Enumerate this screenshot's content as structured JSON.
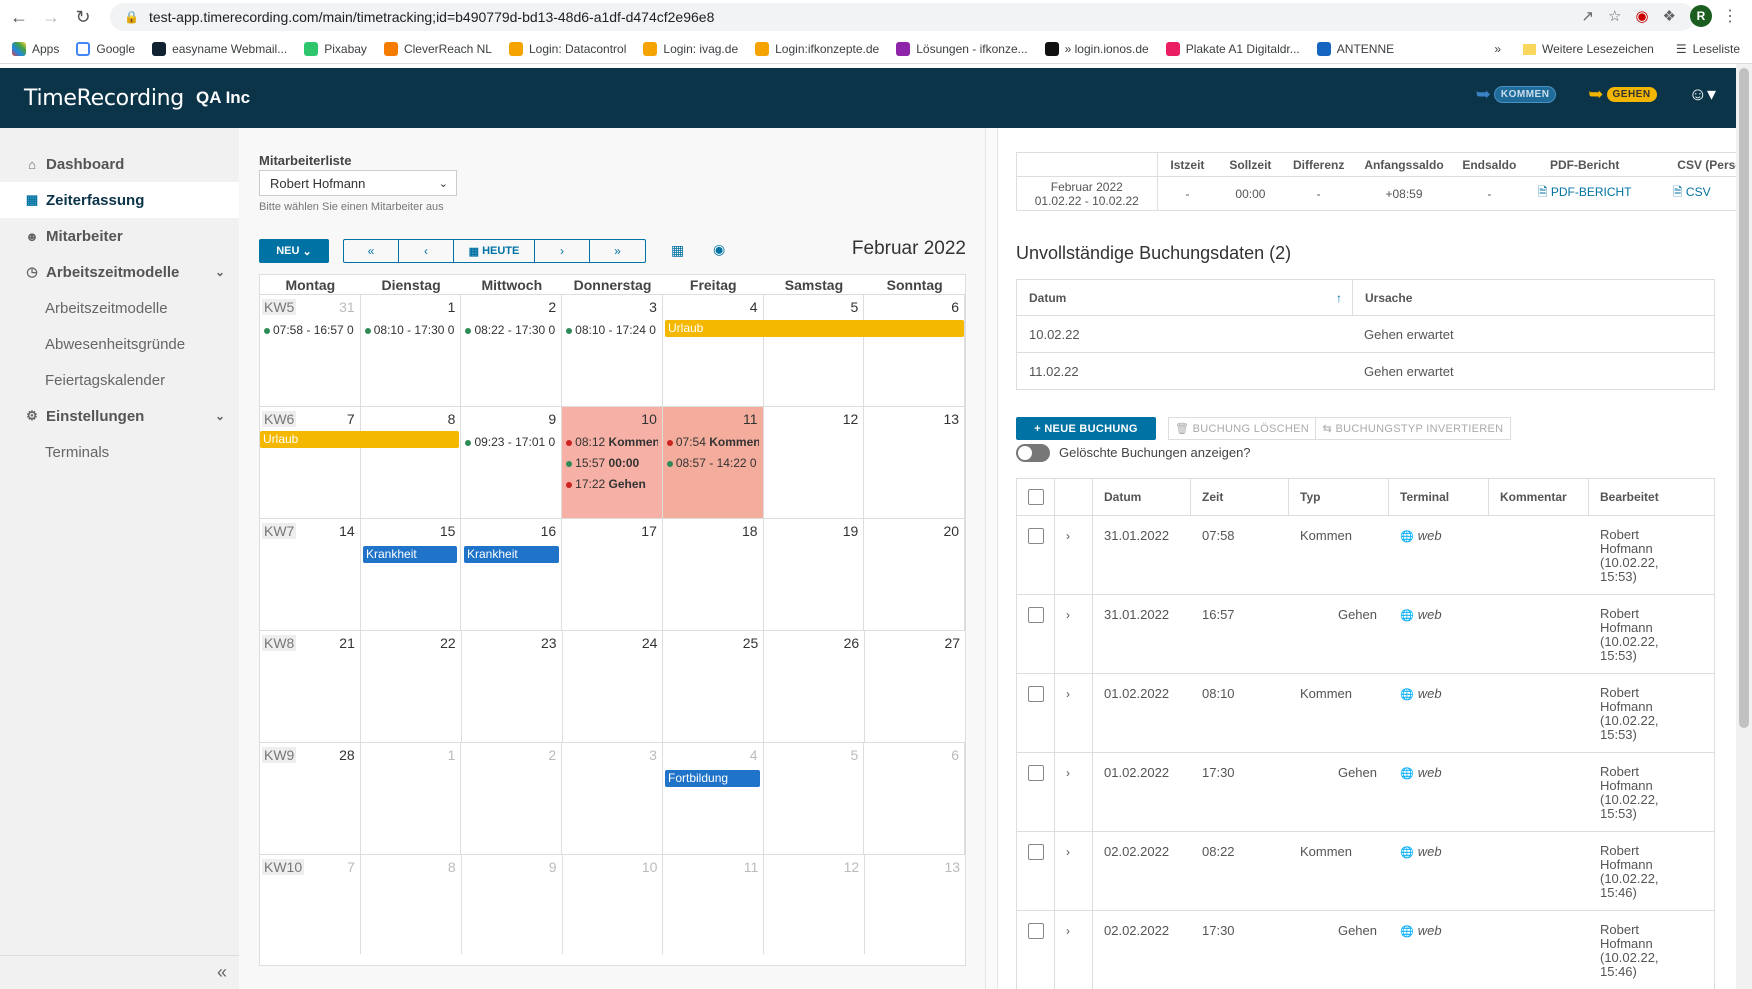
{
  "browser": {
    "url": "test-app.timerecording.com/main/timetracking;id=b490779d-bd13-48d6-a1df-d474cf2e96e8",
    "profile_initial": "R",
    "bookmarks": [
      "Apps",
      "Google",
      "easyname Webmail...",
      "Pixabay",
      "CleverReach NL",
      "Login: Datacontrol",
      "Login: ivag.de",
      "Login:ifkonzepte.de",
      "Lösungen - ifkonze...",
      "» login.ionos.de",
      "Plakate A1 Digitaldr...",
      "ANTENNE"
    ],
    "more_bookmarks": "»",
    "other_bookmarks": "Weitere Lesezeichen",
    "reading_list": "Leseliste"
  },
  "header": {
    "logo": "TimeRecording",
    "company": "QA Inc",
    "kommen_label": "KOMMEN",
    "gehen_label": "GEHEN"
  },
  "sidebar": {
    "items": [
      {
        "label": "Dashboard"
      },
      {
        "label": "Zeiterfassung"
      },
      {
        "label": "Mitarbeiter"
      },
      {
        "label": "Arbeitszeitmodelle"
      },
      {
        "label": "Arbeitszeitmodelle"
      },
      {
        "label": "Abwesenheitsgründe"
      },
      {
        "label": "Feiertagskalender"
      },
      {
        "label": "Einstellungen"
      },
      {
        "label": "Terminals"
      }
    ],
    "collapse": "«"
  },
  "calendar": {
    "employee_list_label": "Mitarbeiterliste",
    "selected_employee": "Robert Hofmann",
    "hint": "Bitte wählen Sie einen Mitarbeiter aus",
    "new_label": "NEU",
    "today_label": "HEUTE",
    "month_title": "Februar 2022",
    "weekdays": [
      "Montag",
      "Dienstag",
      "Mittwoch",
      "Donnerstag",
      "Freitag",
      "Samstag",
      "Sonntag"
    ],
    "weeks": [
      {
        "kw": "KW5",
        "days": [
          "31",
          "1",
          "2",
          "3",
          "4",
          "5",
          "6"
        ]
      },
      {
        "kw": "KW6",
        "days": [
          "7",
          "8",
          "9",
          "10",
          "11",
          "12",
          "13"
        ]
      },
      {
        "kw": "KW7",
        "days": [
          "14",
          "15",
          "16",
          "17",
          "18",
          "19",
          "20"
        ]
      },
      {
        "kw": "KW8",
        "days": [
          "21",
          "22",
          "23",
          "24",
          "25",
          "26",
          "27"
        ]
      },
      {
        "kw": "KW9",
        "days": [
          "28",
          "1",
          "2",
          "3",
          "4",
          "5",
          "6"
        ]
      },
      {
        "kw": "KW10",
        "days": [
          "7",
          "8",
          "9",
          "10",
          "11",
          "12",
          "13"
        ]
      }
    ],
    "events": {
      "w1_mon": "07:58 - 16:57 0",
      "w1_tue": "08:10 - 17:30 0",
      "w1_wed": "08:22 - 17:30 0",
      "w1_thu": "08:10 - 17:24 0",
      "urlaub1": "Urlaub",
      "urlaub2": "Urlaub",
      "w2_wed": "09:23 - 17:01 0",
      "w2_thu_1": "08:12 Kommen",
      "w2_thu_1_time": "08:12",
      "w2_thu_1_text": "Kommen",
      "w2_thu_2_time": "15:57",
      "w2_thu_2_text": "00:00",
      "w2_thu_3_time": "17:22",
      "w2_thu_3_text": "Gehen",
      "w2_fri_1_time": "07:54",
      "w2_fri_1_text": "Kommen",
      "w2_fri_2": "08:57 - 14:22 0",
      "krank1": "Krankheit",
      "krank2": "Krankheit",
      "fortbildung": "Fortbildung"
    }
  },
  "summary": {
    "headers": [
      "Istzeit",
      "Sollzeit",
      "Differenz",
      "Anfangssaldo",
      "Endsaldo",
      "PDF-Bericht",
      "CSV (Perso"
    ],
    "period_month": "Februar 2022",
    "period_range": "01.02.22 - 10.02.22",
    "values": [
      "-",
      "00:00",
      "-",
      "+08:59",
      "-"
    ],
    "pdf_link": "PDF-BERICHT",
    "csv_link": "CSV"
  },
  "incomplete": {
    "title": "Unvollständige Buchungsdaten (2)",
    "col_date": "Datum",
    "col_reason": "Ursache",
    "rows": [
      {
        "date": "10.02.22",
        "reason": "Gehen erwartet"
      },
      {
        "date": "11.02.22",
        "reason": "Gehen erwartet"
      }
    ]
  },
  "bookings": {
    "new_label": "+ NEUE BUCHUNG",
    "delete_label": "BUCHUNG LÖSCHEN",
    "invert_label": "BUCHUNGSTYP INVERTIEREN",
    "show_deleted": "Gelöschte Buchungen anzeigen?",
    "columns": [
      "Datum",
      "Zeit",
      "Typ",
      "Terminal",
      "Kommentar",
      "Bearbeitet"
    ],
    "rows": [
      {
        "date": "31.01.2022",
        "time": "07:58",
        "type": "Kommen",
        "terminal": "web",
        "edited1": "Robert",
        "edited2": "Hofmann",
        "edited3": "(10.02.22,",
        "edited4": "15:53)"
      },
      {
        "date": "31.01.2022",
        "time": "16:57",
        "type": "Gehen",
        "terminal": "web",
        "edited1": "Robert",
        "edited2": "Hofmann",
        "edited3": "(10.02.22,",
        "edited4": "15:53)"
      },
      {
        "date": "01.02.2022",
        "time": "08:10",
        "type": "Kommen",
        "terminal": "web",
        "edited1": "Robert",
        "edited2": "Hofmann",
        "edited3": "(10.02.22,",
        "edited4": "15:53)"
      },
      {
        "date": "01.02.2022",
        "time": "17:30",
        "type": "Gehen",
        "terminal": "web",
        "edited1": "Robert",
        "edited2": "Hofmann",
        "edited3": "(10.02.22,",
        "edited4": "15:53)"
      },
      {
        "date": "02.02.2022",
        "time": "08:22",
        "type": "Kommen",
        "terminal": "web",
        "edited1": "Robert",
        "edited2": "Hofmann",
        "edited3": "(10.02.22,",
        "edited4": "15:46)"
      },
      {
        "date": "02.02.2022",
        "time": "17:30",
        "type": "Gehen",
        "terminal": "web",
        "edited1": "Robert",
        "edited2": "Hofmann",
        "edited3": "(10.02.22,",
        "edited4": "15:46)"
      }
    ]
  },
  "colors": {
    "header_bg": "#0b3449",
    "accent": "#0072a3",
    "urlaub": "#f5b800",
    "krankheit": "#1f73c8",
    "error_day": "#f6b0a6"
  }
}
